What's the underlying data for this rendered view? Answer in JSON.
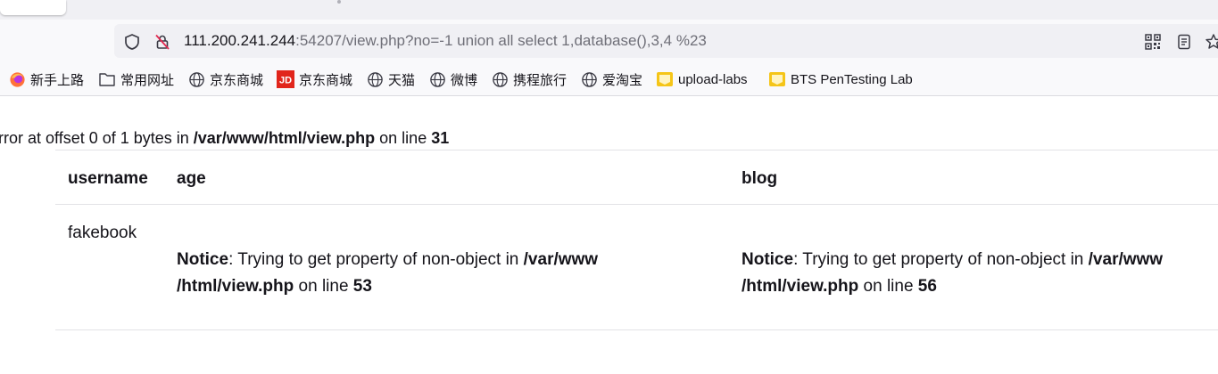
{
  "browser": {
    "url_host": "111.200.241.244",
    "url_rest": ":54207/view.php?no=-1 union all select 1,database(),3,4 %23"
  },
  "bookmarks": [
    {
      "label": "新手上路",
      "icon": "firefox-icon"
    },
    {
      "label": "常用网址",
      "icon": "folder-icon"
    },
    {
      "label": "京东商城",
      "icon": "globe-icon"
    },
    {
      "label": "京东商城",
      "icon": "jd-icon"
    },
    {
      "label": "天猫",
      "icon": "globe-icon"
    },
    {
      "label": "微博",
      "icon": "globe-icon"
    },
    {
      "label": "携程旅行",
      "icon": "globe-icon"
    },
    {
      "label": "爱淘宝",
      "icon": "globe-icon"
    },
    {
      "label": "upload-labs",
      "icon": "folder-yellow-icon"
    },
    {
      "label": "BTS PenTesting Lab",
      "icon": "folder-yellow-icon"
    }
  ],
  "page": {
    "error": {
      "prefix": "rror at offset 0 of 1 bytes in ",
      "path": "/var/www/html/view.php",
      "on_line": " on line ",
      "line": "31"
    },
    "table": {
      "headers": [
        "username",
        "age",
        "blog"
      ],
      "username": "fakebook",
      "age_notice": {
        "label": "Notice",
        "msg": ": Trying to get property of non-object in ",
        "path1": "/var/www",
        "path2": "/html/view.php",
        "on_line": " on line ",
        "line": "53"
      },
      "blog_notice": {
        "label": "Notice",
        "msg": ": Trying to get property of non-object in ",
        "path1": "/var/www",
        "path2": "/html/view.php",
        "on_line": " on line ",
        "line": "56"
      }
    }
  }
}
